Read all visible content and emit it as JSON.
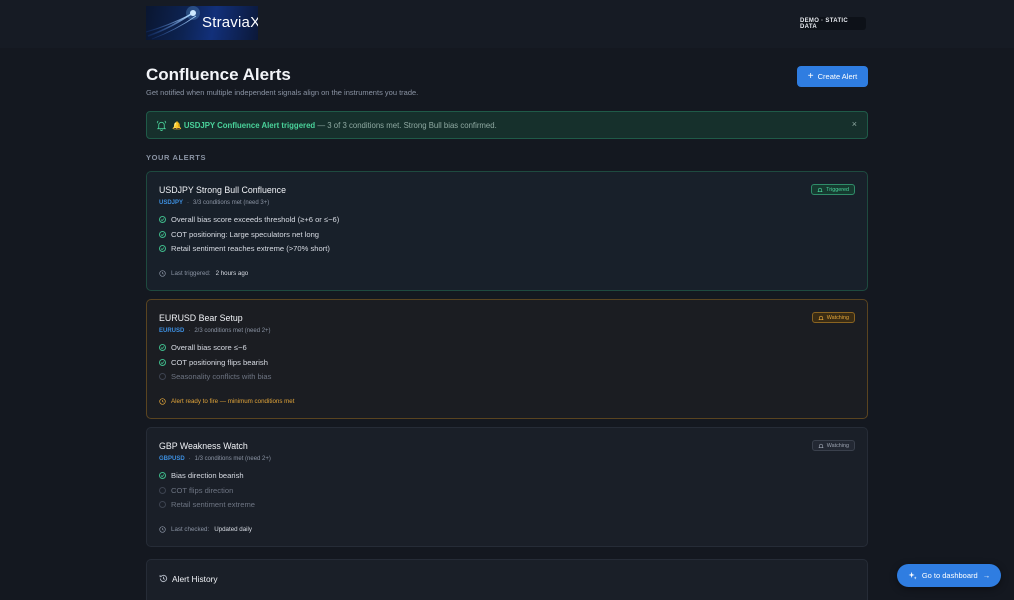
{
  "brand": {
    "name": "StraviaX",
    "logo_icon": "light-streak-logo"
  },
  "header": {
    "demo_badge": "DEMO · STATIC DATA"
  },
  "page": {
    "title": "Confluence Alerts",
    "subtitle": "Get notified when multiple independent signals align on the instruments you trade.",
    "create_button": "Create Alert"
  },
  "banner": {
    "emoji": "🔔",
    "highlight": "USDJPY Confluence Alert triggered",
    "rest": " — 3 of 3 conditions met. Strong Bull bias confirmed.",
    "close": "×"
  },
  "alerts_section": {
    "label": "YOUR ALERTS"
  },
  "alerts": [
    {
      "title": "USDJPY Strong Bull Confluence",
      "symbol": "USDJPY",
      "meta": "3/3 conditions met (need 3+)",
      "status": "Triggered",
      "conditions": [
        {
          "text": "Overall bias score exceeds threshold (≥+6 or ≤−6)",
          "met": true
        },
        {
          "text": "COT positioning: Large speculators net long",
          "met": true
        },
        {
          "text": "Retail sentiment reaches extreme (>70% short)",
          "met": true
        }
      ],
      "footer_label": "Last triggered:",
      "footer_value": "2 hours ago"
    },
    {
      "title": "EURUSD Bear Setup",
      "symbol": "EURUSD",
      "meta": "2/3 conditions met (need 2+)",
      "status": "Watching",
      "conditions": [
        {
          "text": "Overall bias score ≤−6",
          "met": true
        },
        {
          "text": "COT positioning flips bearish",
          "met": true
        },
        {
          "text": "Seasonality conflicts with bias",
          "met": false
        }
      ],
      "footer_label": "Alert ready to fire — minimum conditions met",
      "footer_value": ""
    },
    {
      "title": "GBP Weakness Watch",
      "symbol": "GBPUSD",
      "meta": "1/3 conditions met (need 2+)",
      "status": "Watching",
      "conditions": [
        {
          "text": "Bias direction bearish",
          "met": true
        },
        {
          "text": "COT flips direction",
          "met": false
        },
        {
          "text": "Retail sentiment extreme",
          "met": false
        }
      ],
      "footer_label": "Last checked:",
      "footer_value": "Updated daily"
    }
  ],
  "history": {
    "title": "Alert History"
  },
  "dashboard_button": "Go to dashboard",
  "colors": {
    "background": "#141820",
    "accent": "#2f7de1",
    "success": "#4ad39b",
    "warning": "#e2a53a",
    "symbol": "#3d8fe0"
  }
}
